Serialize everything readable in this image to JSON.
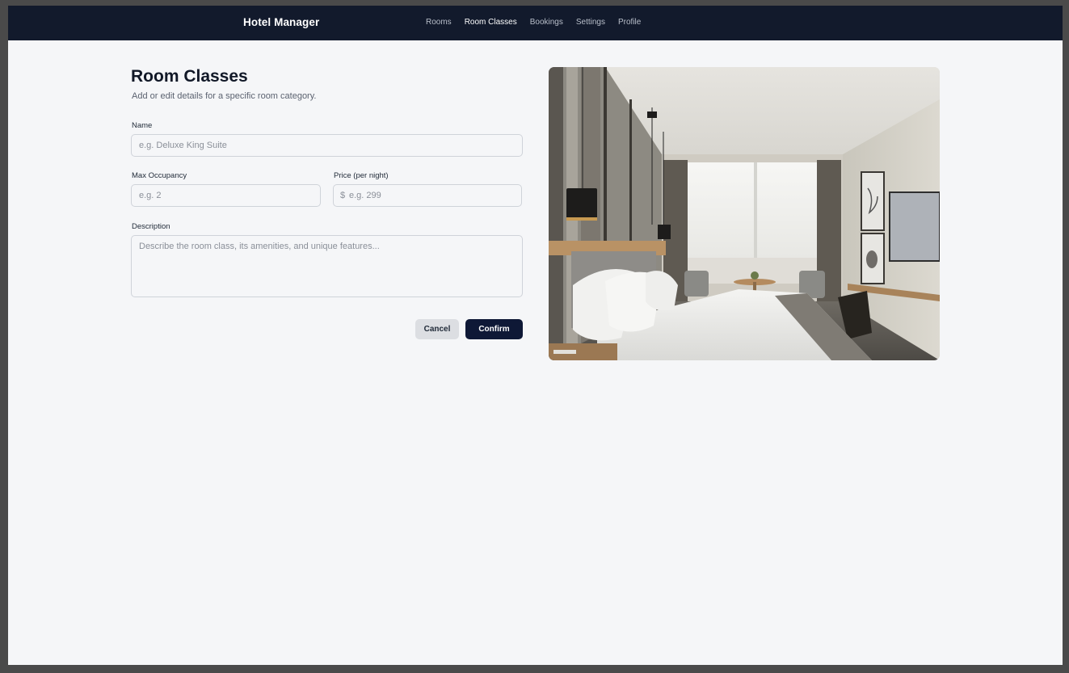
{
  "app": {
    "brand": "Hotel Manager"
  },
  "nav": {
    "items": [
      {
        "label": "Rooms",
        "active": false
      },
      {
        "label": "Room Classes",
        "active": true
      },
      {
        "label": "Bookings",
        "active": false
      },
      {
        "label": "Settings",
        "active": false
      },
      {
        "label": "Profile",
        "active": false
      }
    ]
  },
  "page": {
    "title": "Room Classes",
    "subtitle": "Add or edit details for a specific room category."
  },
  "form": {
    "name": {
      "label": "Name",
      "value": "",
      "placeholder": "e.g. Deluxe King Suite"
    },
    "max_occupancy": {
      "label": "Max Occupancy",
      "value": "",
      "placeholder": "e.g. 2"
    },
    "price": {
      "label": "Price (per night)",
      "prefix": "$",
      "value": "",
      "placeholder": "e.g. 299"
    },
    "description": {
      "label": "Description",
      "value": "",
      "placeholder": "Describe the room class, its amenities, and unique features..."
    },
    "cancel_label": "Cancel",
    "confirm_label": "Confirm"
  },
  "colors": {
    "navbar": "#121a2c",
    "page_background": "#f5f6f8",
    "primary_button": "#0e1836",
    "secondary_button": "#dcdee2"
  }
}
